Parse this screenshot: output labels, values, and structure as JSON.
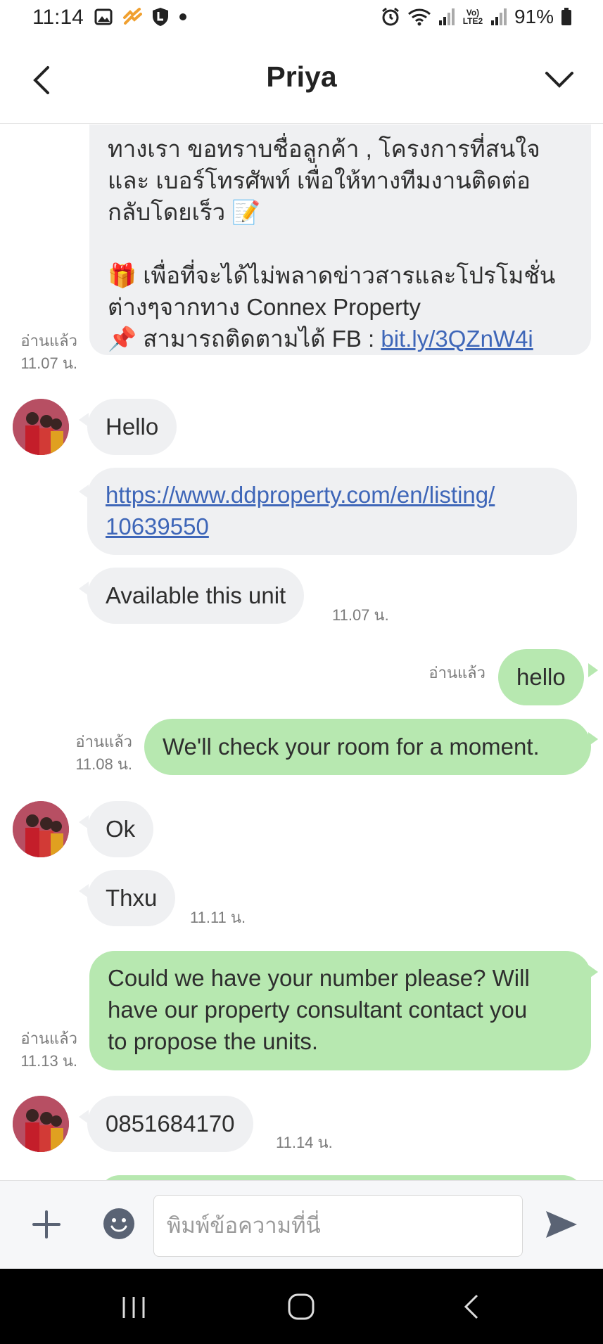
{
  "status_bar": {
    "time": "11:14",
    "battery": "91%",
    "network_label": "Vo) LTE2"
  },
  "header": {
    "title": "Priya"
  },
  "messages": {
    "m1": {
      "lines": [
        "ทางเรา ขอทราบชื่อลูกค้า , โครงการที่สนใจ",
        "และ เบอร์โทรศัพท์ เพื่อให้ทางทีมงานติดต่อ",
        "กลับโดยเร็ว 📝",
        "",
        "🎁 เพื่อที่จะได้ไม่พลาดข่าวสารและโปรโมชั่น",
        "ต่างๆจากทาง Connex Property",
        "📌 สามารถติดตามได้ FB : "
      ],
      "link": "bit.ly/3QZnW4i",
      "read": "อ่านแล้ว",
      "time": "11.07 น."
    },
    "m2": {
      "text": "Hello"
    },
    "m3": {
      "link_line1": "https://www.ddproperty.com/en/listing/",
      "link_line2": "10639550"
    },
    "m4": {
      "text": "Available this unit",
      "time": "11.07 น."
    },
    "m5": {
      "text": "hello",
      "read": "อ่านแล้ว"
    },
    "m6": {
      "text": "We'll check your room for a moment.",
      "read": "อ่านแล้ว",
      "time": "11.08 น."
    },
    "m7": {
      "text": "Ok"
    },
    "m8": {
      "text": "Thxu",
      "time": "11.11 น."
    },
    "m9": {
      "line1": "Could we have your number please? Will",
      "line2": "have our property consultant contact you",
      "line3": "to propose the units.",
      "read": "อ่านแล้ว",
      "time": "11.13 น."
    },
    "m10": {
      "text": "0851684170",
      "time": "11.14 น."
    }
  },
  "composer": {
    "placeholder": "พิมพ์ข้อความที่นี่"
  },
  "colors": {
    "incoming_bubble": "#eff0f2",
    "outgoing_bubble": "#b7e8b0",
    "link": "#3e66b8"
  },
  "icons": {
    "back": "chevron-left-icon",
    "dropdown": "chevron-down-icon",
    "add": "plus-icon",
    "emoji": "emoji-icon",
    "send": "send-icon"
  }
}
